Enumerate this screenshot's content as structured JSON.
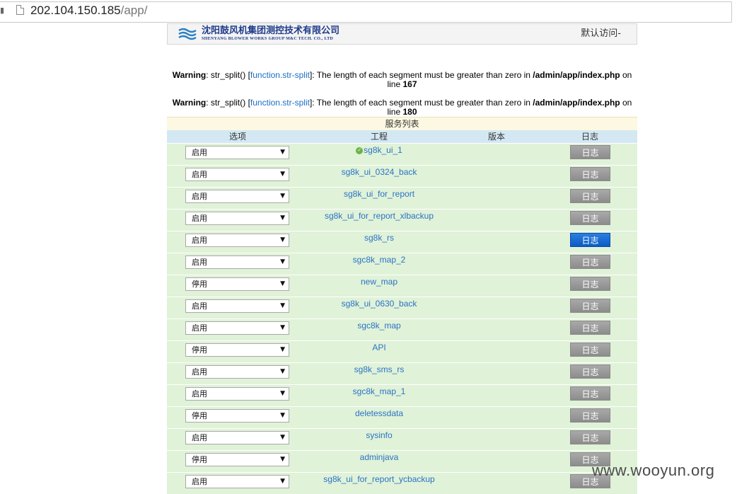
{
  "browser": {
    "url_host": "202.104.150.185",
    "url_path": "/app/"
  },
  "header": {
    "company_cn": "沈阳鼓风机集团测控技术有限公司",
    "company_en": "SHENYANG BLOWER WORKS GROUP M&C TECH. CO., LTD",
    "user_menu": "默认访问-"
  },
  "warnings": [
    {
      "label": "Warning",
      "func": ": str_split() [",
      "link": "function.str-split",
      "msg": "]: The length of each segment must be greater than zero in ",
      "file": "/admin/app/index.php",
      "on": " on",
      "line_word": "line ",
      "line": "167"
    },
    {
      "label": "Warning",
      "func": ": str_split() [",
      "link": "function.str-split",
      "msg": "]: The length of each segment must be greater than zero in ",
      "file": "/admin/app/index.php",
      "on": " on",
      "line_word": "line ",
      "line": "180"
    }
  ],
  "table": {
    "title": "服务列表",
    "headers": {
      "option": "选项",
      "project": "工程",
      "version": "版本",
      "log": "日志"
    },
    "log_label": "日志",
    "rows": [
      {
        "option": "启用",
        "project": "sg8k_ui_1",
        "status_ok": true,
        "active": false
      },
      {
        "option": "启用",
        "project": "sg8k_ui_0324_back",
        "active": false
      },
      {
        "option": "启用",
        "project": "sg8k_ui_for_report",
        "active": false
      },
      {
        "option": "启用",
        "project": "sg8k_ui_for_report_xlbackup",
        "active": false
      },
      {
        "option": "启用",
        "project": "sg8k_rs",
        "active": true
      },
      {
        "option": "启用",
        "project": "sgc8k_map_2",
        "active": false
      },
      {
        "option": "停用",
        "project": "new_map",
        "active": false
      },
      {
        "option": "启用",
        "project": "sg8k_ui_0630_back",
        "active": false
      },
      {
        "option": "启用",
        "project": "sgc8k_map",
        "active": false
      },
      {
        "option": "停用",
        "project": "API",
        "active": false
      },
      {
        "option": "启用",
        "project": "sg8k_sms_rs",
        "active": false
      },
      {
        "option": "启用",
        "project": "sgc8k_map_1",
        "active": false
      },
      {
        "option": "停用",
        "project": "deletessdata",
        "active": false
      },
      {
        "option": "启用",
        "project": "sysinfo",
        "active": false
      },
      {
        "option": "停用",
        "project": "adminjava",
        "active": false
      },
      {
        "option": "启用",
        "project": "sg8k_ui_for_report_ycbackup",
        "active": false
      }
    ]
  },
  "watermark": "www.wooyun.org"
}
